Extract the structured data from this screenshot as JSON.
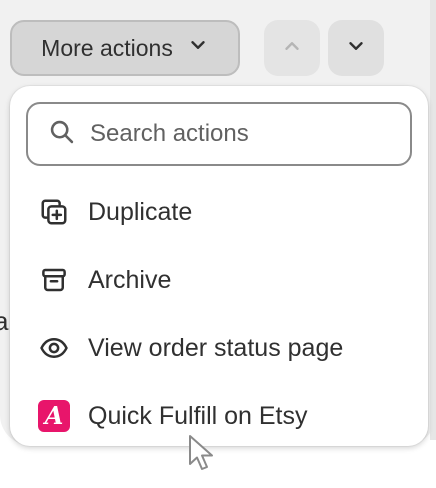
{
  "toolbar": {
    "more_actions_label": "More actions",
    "prev_icon": "chevron-up-icon",
    "next_icon": "chevron-down-icon"
  },
  "background": {
    "stray_text": "a"
  },
  "dropdown": {
    "search": {
      "placeholder": "Search actions",
      "value": "",
      "icon": "search-icon"
    },
    "items": [
      {
        "label": "Duplicate",
        "icon": "duplicate-icon"
      },
      {
        "label": "Archive",
        "icon": "archive-icon"
      },
      {
        "label": "View order status page",
        "icon": "eye-icon"
      },
      {
        "label": "Quick Fulfill on Etsy",
        "icon": "etsy-app-icon",
        "badge_letter": "A"
      }
    ]
  },
  "colors": {
    "text": "#303030",
    "button_bg": "#d6d6d6",
    "etsy_badge": "#e8156b",
    "page_bg": "#f1f1f1"
  }
}
